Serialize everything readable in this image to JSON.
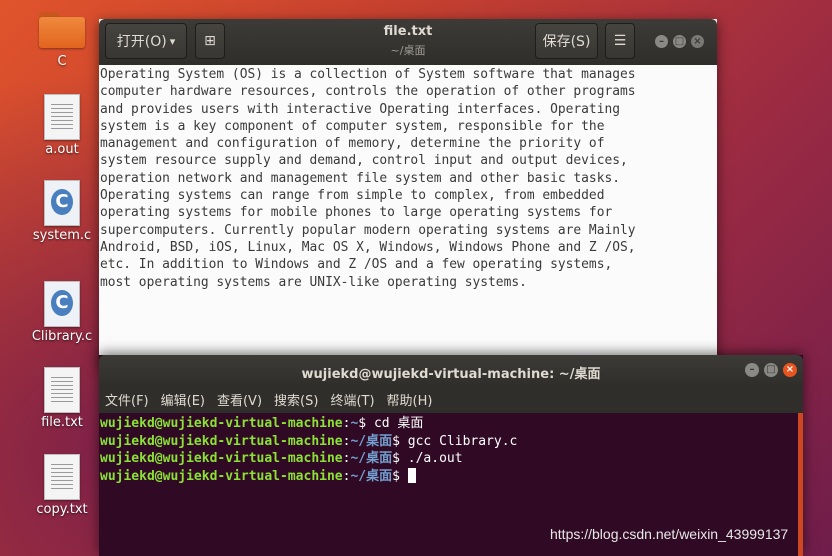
{
  "desktop": {
    "icons": [
      {
        "label": "C",
        "icon": "folder-icon"
      },
      {
        "label": "a.out",
        "icon": "binary-file-icon"
      },
      {
        "label": "system.c",
        "icon": "c-source-icon"
      },
      {
        "label": "Clibrary.c",
        "icon": "c-source-icon"
      },
      {
        "label": "file.txt",
        "icon": "text-file-icon"
      },
      {
        "label": "copy.txt",
        "icon": "text-file-icon"
      }
    ]
  },
  "gedit": {
    "open_label": "打开(O)",
    "open_arrow": "▾",
    "new_tab_glyph": "⊞",
    "title": "file.txt",
    "subtitle": "~/桌面",
    "save_label": "保存(S)",
    "menu_glyph": "☰",
    "content": "Operating System (OS) is a collection of System software that manages\ncomputer hardware resources, controls the operation of other programs\nand provides users with interactive Operating interfaces. Operating\nsystem is a key component of computer system, responsible for the\nmanagement and configuration of memory, determine the priority of\nsystem resource supply and demand, control input and output devices,\noperation network and management file system and other basic tasks.\nOperating systems can range from simple to complex, from embedded\noperating systems for mobile phones to large operating systems for\nsupercomputers. Currently popular modern operating systems are Mainly\nAndroid, BSD, iOS, Linux, Mac OS X, Windows, Windows Phone and Z /OS,\netc. In addition to Windows and Z /OS and a few operating systems,\nmost operating systems are UNIX-like operating systems."
  },
  "terminal": {
    "title": "wujiekd@wujiekd-virtual-machine: ~/桌面",
    "menu": [
      "文件(F)",
      "编辑(E)",
      "查看(V)",
      "搜索(S)",
      "终端(T)",
      "帮助(H)"
    ],
    "user_host": "wujiekd@wujiekd-virtual-machine",
    "lines": [
      {
        "path": "~",
        "command": " cd 桌面"
      },
      {
        "path": "~/桌面",
        "command": " gcc Clibrary.c"
      },
      {
        "path": "~/桌面",
        "command": " ./a.out"
      },
      {
        "path": "~/桌面",
        "command": " "
      }
    ]
  },
  "window_controls": {
    "minimize": "–",
    "maximize": "□",
    "close": "×"
  },
  "watermark": "https://blog.csdn.net/weixin_43999137",
  "colors": {
    "ubuntu_orange": "#e95420",
    "terminal_bg": "#300a24",
    "prompt_user": "#8ae234",
    "prompt_path": "#729fcf"
  }
}
